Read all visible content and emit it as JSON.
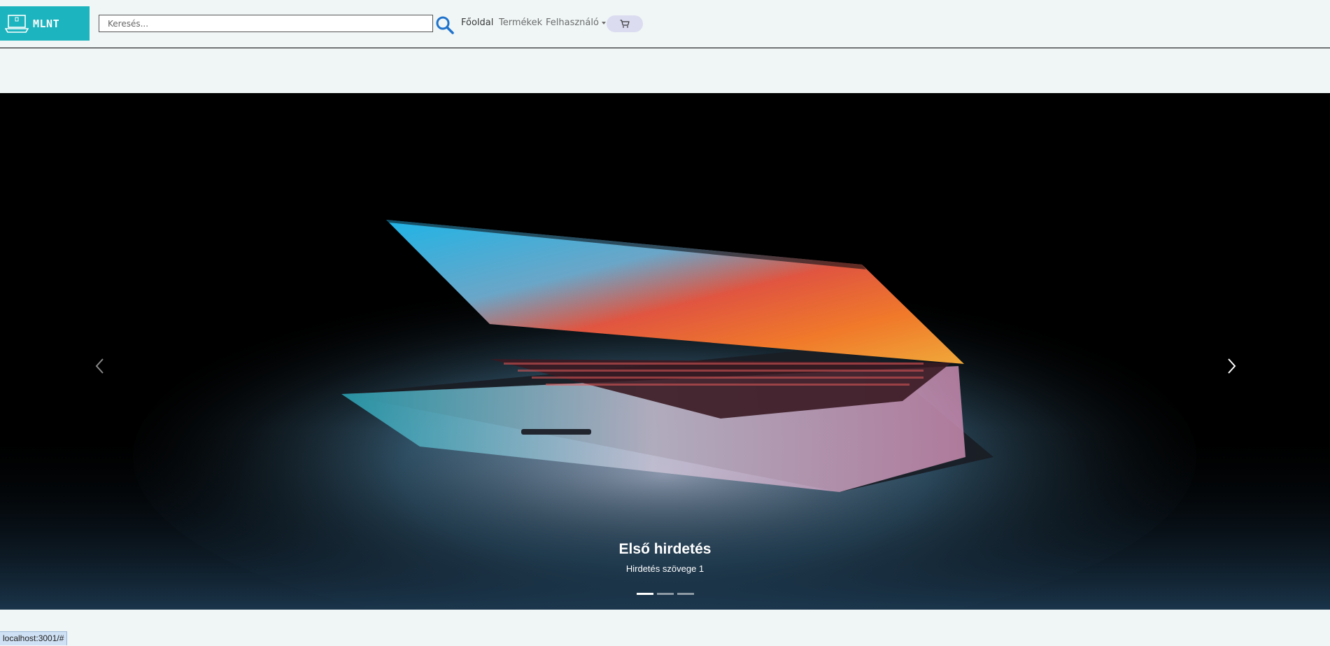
{
  "brand": {
    "name": "MLNT",
    "color": "#1cb4be",
    "logo_icon": "laptop-icon"
  },
  "search": {
    "placeholder": "Keresés...",
    "value": "",
    "icon": "search-icon",
    "icon_color": "#1f73cc"
  },
  "nav": {
    "home": "Főoldal",
    "products": "Termékek",
    "user": "Felhasználó",
    "cart_icon": "cart-icon"
  },
  "carousel": {
    "active_index": 0,
    "slide_count": 3,
    "slide": {
      "title": "Első hirdetés",
      "text": "Hirdetés szövege 1",
      "image": "laptop-photo"
    },
    "prev_icon": "chevron-left-icon",
    "next_icon": "chevron-right-icon"
  },
  "status_bar": {
    "url": "localhost:3001/#"
  },
  "colors": {
    "background": "#f0f6f6",
    "cart_button": "#dbdcf0",
    "carousel_bg": "#000000"
  }
}
